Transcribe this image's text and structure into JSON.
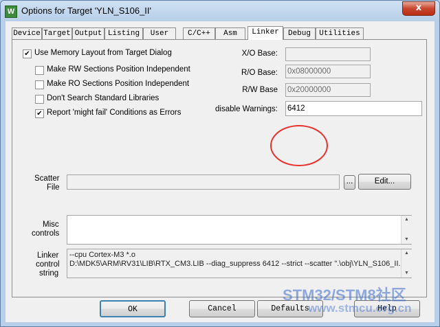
{
  "window": {
    "title": "Options for Target 'YLN_S106_II'",
    "close_glyph": "x"
  },
  "tabs": [
    {
      "label": "Device"
    },
    {
      "label": "Target"
    },
    {
      "label": "Output"
    },
    {
      "label": "Listing"
    },
    {
      "label": "User"
    },
    {
      "label": "C/C++"
    },
    {
      "label": "Asm"
    },
    {
      "label": "Linker",
      "active": true
    },
    {
      "label": "Debug"
    },
    {
      "label": "Utilities"
    }
  ],
  "options": {
    "use_memory_layout": {
      "label": "Use Memory Layout from Target Dialog",
      "checked": true
    },
    "rw_independent": {
      "label": "Make RW Sections Position Independent",
      "checked": false
    },
    "ro_independent": {
      "label": "Make RO Sections Position Independent",
      "checked": false
    },
    "dont_search_std": {
      "label": "Don't Search Standard Libraries",
      "checked": false
    },
    "might_fail_errors": {
      "label": "Report 'might fail' Conditions as Errors",
      "checked": true
    }
  },
  "bases": {
    "xo": {
      "label": "X/O Base:",
      "value": ""
    },
    "ro": {
      "label": "R/O Base:",
      "value": "0x08000000"
    },
    "rw": {
      "label": "R/W Base",
      "value": "0x20000000"
    },
    "warnings": {
      "label": "disable Warnings:",
      "value": "6412"
    }
  },
  "scatter": {
    "label_line1": "Scatter",
    "label_line2": "File",
    "value": "",
    "browse_label": "...",
    "edit_label": "Edit..."
  },
  "misc": {
    "label_line1": "Misc",
    "label_line2": "controls",
    "value": ""
  },
  "linker": {
    "label_line1": "Linker",
    "label_line2": "control",
    "label_line3": "string",
    "line1": "--cpu Cortex-M3 *.o",
    "line2": "D:\\MDK5\\ARM\\RV31\\LIB\\RTX_CM3.LIB --diag_suppress 6412 --strict --scatter \".\\obj\\YLN_S106_II."
  },
  "buttons": {
    "ok": "OK",
    "cancel": "Cancel",
    "defaults": "Defaults",
    "help": "Help"
  },
  "watermark": {
    "line1": "STM32/STM8社区",
    "line2": "www.stmcu.org.cn"
  },
  "colors": {
    "annotation_circle": "#e8312d",
    "watermark": "#3f6fd0"
  }
}
